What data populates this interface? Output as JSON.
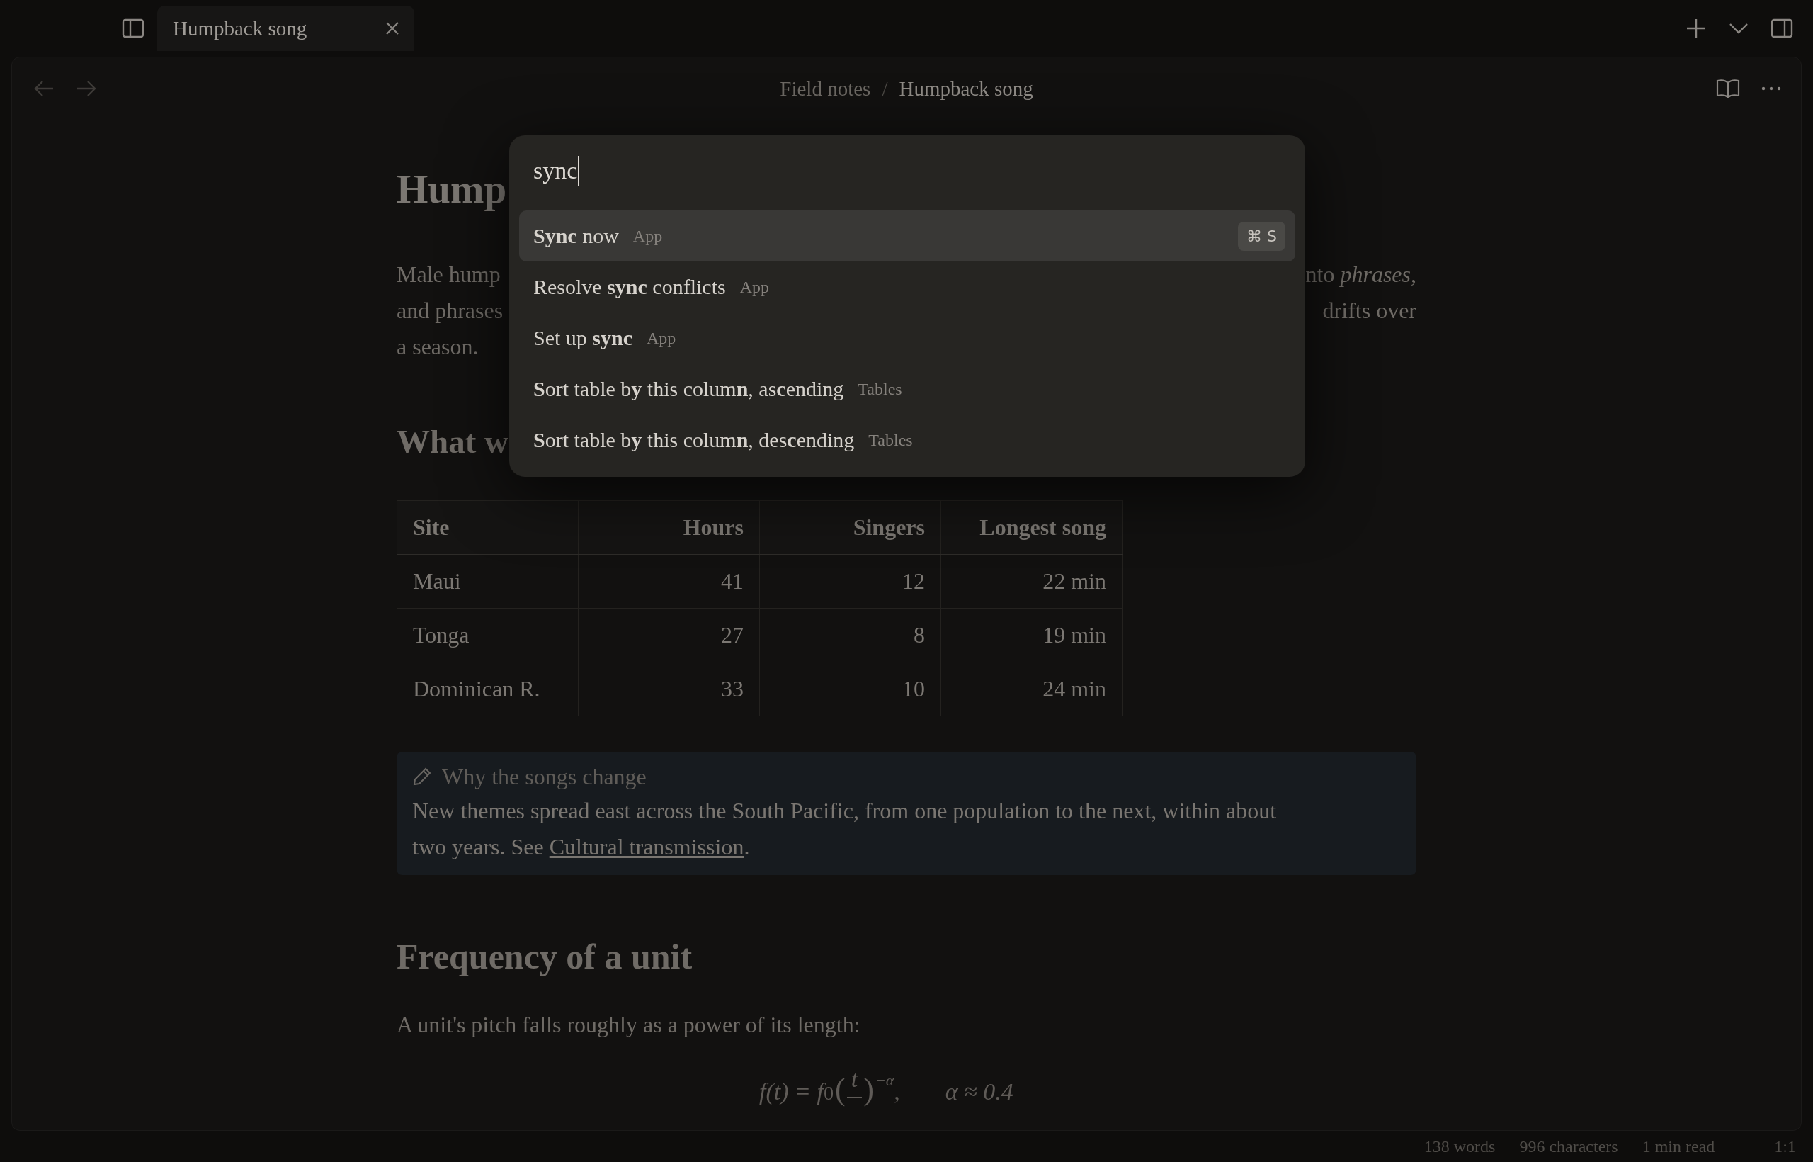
{
  "tab_bar": {
    "tabs": [
      {
        "title": "Humpback song",
        "selected": true
      }
    ]
  },
  "breadcrumb": {
    "folder": "Field notes",
    "separator": "/",
    "note": "Humpback song"
  },
  "note": {
    "title": "Hump",
    "intro_lines": [
      {
        "left": "Male hump",
        "right": "nto *phrases*,"
      },
      {
        "left": "and phrases",
        "right": "drifts over"
      },
      {
        "left": "a season."
      }
    ],
    "section_heading": "What w",
    "table": {
      "columns": [
        "Site",
        "Hours",
        "Singers",
        "Longest song"
      ],
      "rows": [
        [
          "Maui",
          "41",
          "12",
          "22 min"
        ],
        [
          "Tonga",
          "27",
          "8",
          "19 min"
        ],
        [
          "Dominican R.",
          "33",
          "10",
          "24 min"
        ]
      ]
    },
    "callout": {
      "title": "Why the songs change",
      "text": "New themes spread east across the South Pacific, from one population to the next, within about two years. See",
      "link": "Cultural transmission",
      "after": "."
    },
    "heading_2": "Frequency of a unit",
    "paragraph": "A unit's pitch falls roughly as a power of its length:",
    "formula": {
      "lhs": "f(t) = f",
      "subscript": "0",
      "open": "(",
      "numerator": "t",
      "close": ")",
      "exponent": "−α",
      "comma": ",",
      "rhs": "α ≈ 0.4"
    }
  },
  "command_palette": {
    "query": "sync",
    "results": [
      {
        "label": "**Sync** now",
        "source": "App",
        "shortcut": "⌘ S",
        "selected": true
      },
      {
        "label": "Resolve **sync** conflicts",
        "source": "App",
        "selected": false
      },
      {
        "label": "Set up **sync**",
        "source": "App",
        "selected": false
      },
      {
        "label": "**S**ort table b**y** this colum**n**, as**c**ending",
        "source": "Tables",
        "selected": false
      },
      {
        "label": "**S**ort table b**y** this colum**n**, des**c**ending",
        "source": "Tables",
        "selected": false
      }
    ]
  },
  "status_bar": [
    "138 words",
    "996 characters",
    "1 min read",
    "1:1"
  ]
}
